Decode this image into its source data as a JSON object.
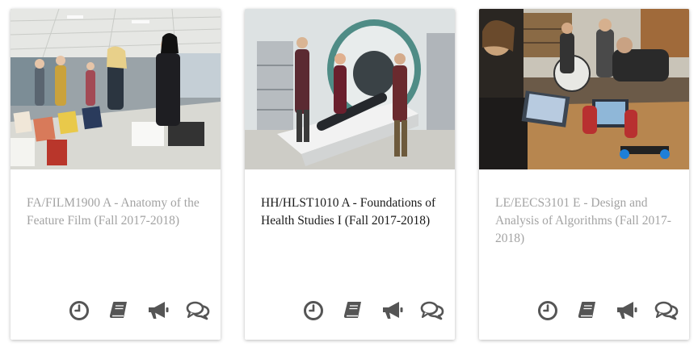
{
  "cards": [
    {
      "title": "FA/FILM1900 A - Anatomy of the Feature Film (Fall 2017-2018)",
      "state": "inactive",
      "image": "classroom-students-reviewing-posters",
      "icons": [
        "clock-icon",
        "book-icon",
        "megaphone-icon",
        "chat-icon"
      ]
    },
    {
      "title": "HH/HLST1010 A - Foundations of Health Studies I (Fall 2017-2018)",
      "state": "active",
      "image": "mri-scanner-lab",
      "icons": [
        "clock-icon",
        "book-icon",
        "megaphone-icon",
        "chat-icon"
      ]
    },
    {
      "title": "LE/EECS3101 E - Design and Analysis of Algorithms (Fall 2017-2018)",
      "state": "inactive",
      "image": "robotics-lab-laptop",
      "icons": [
        "clock-icon",
        "book-icon",
        "megaphone-icon",
        "chat-icon"
      ]
    }
  ],
  "colors": {
    "icon": "#555555",
    "muted_text": "#a3a3a3",
    "active_text": "#1a1a1a"
  }
}
